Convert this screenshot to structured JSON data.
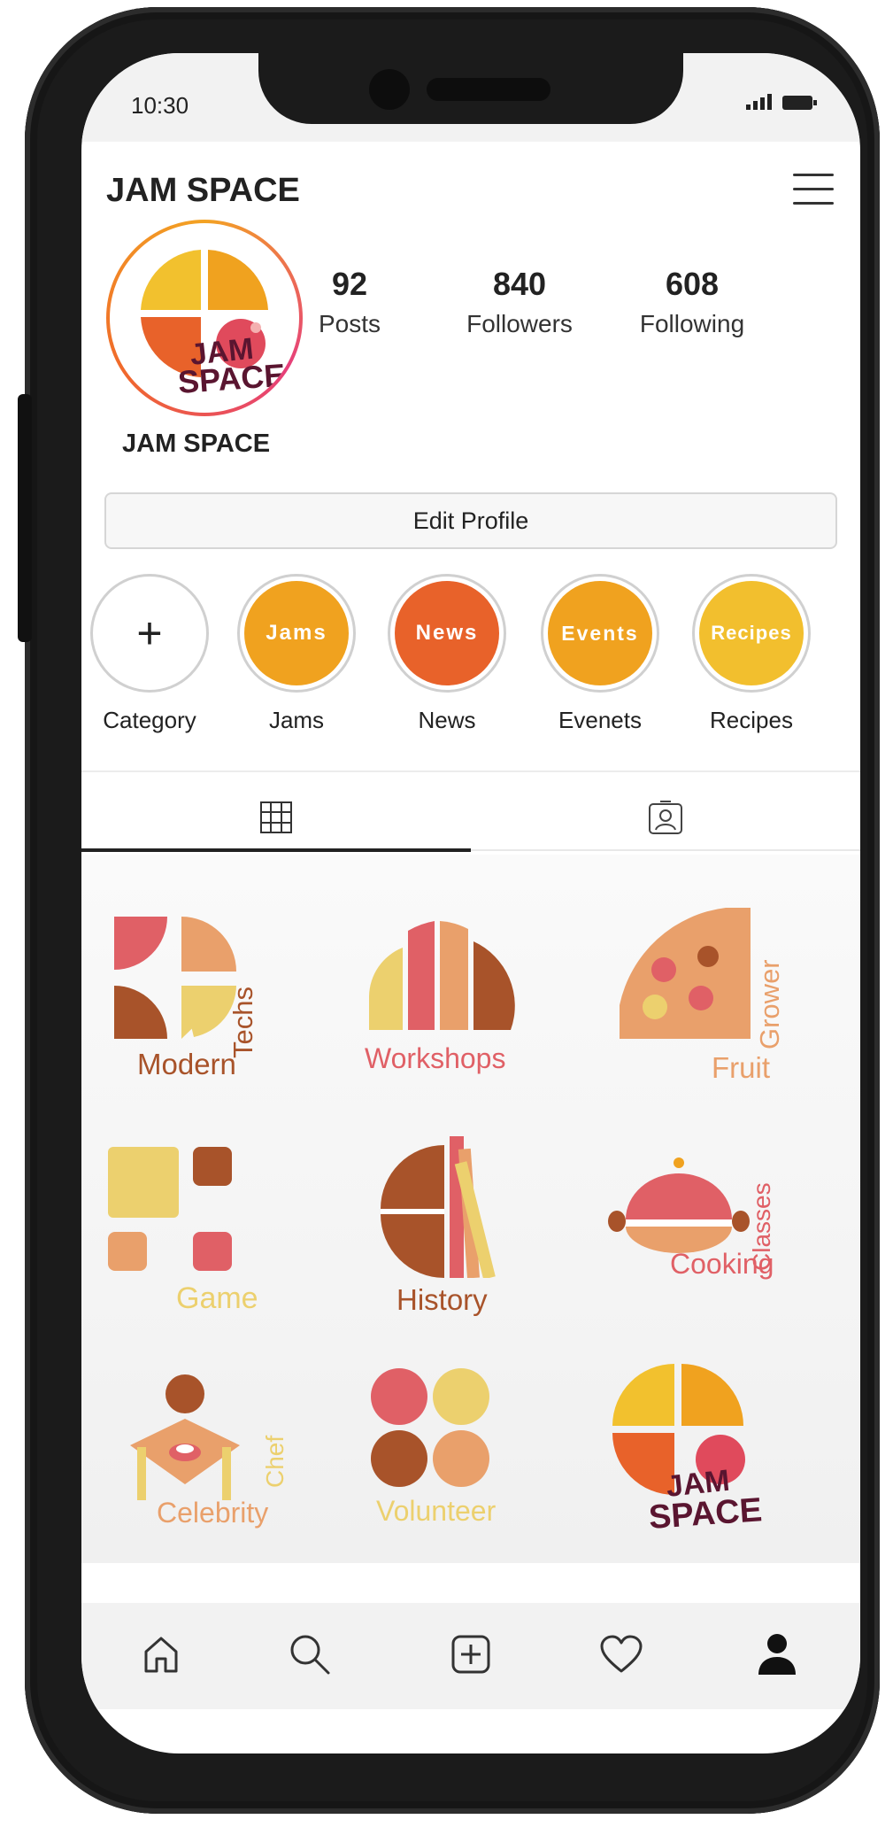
{
  "status_bar": {
    "time": "10:30"
  },
  "header": {
    "title": "JAM SPACE",
    "menu_icon": "hamburger-menu-icon"
  },
  "profile": {
    "avatar_text_line1": "JAM",
    "avatar_text_line2": "SPACE",
    "name": "JAM SPACE",
    "stats": [
      {
        "value": "92",
        "label": "Posts"
      },
      {
        "value": "840",
        "label": "Followers"
      },
      {
        "value": "608",
        "label": "Following"
      }
    ],
    "edit_button": "Edit Profile"
  },
  "highlights": [
    {
      "caption": "Category",
      "inner": "+",
      "color": "#ffffff"
    },
    {
      "caption": "Jams",
      "inner": "Jams",
      "color": "#f0a21f"
    },
    {
      "caption": "News",
      "inner": "News",
      "color": "#e8622a"
    },
    {
      "caption": "Evenets",
      "inner": "Events",
      "color": "#f0a21f"
    },
    {
      "caption": "Recipes",
      "inner": "Recipes",
      "color": "#f2bf2e"
    }
  ],
  "tabs": [
    {
      "name": "grid",
      "icon": "grid-icon"
    },
    {
      "name": "tagged",
      "icon": "tagged-person-icon"
    }
  ],
  "posts": [
    {
      "title": "Modern",
      "subtitle": "Techs"
    },
    {
      "title": "Workshops",
      "subtitle": ""
    },
    {
      "title": "Fruit",
      "subtitle": "Grower"
    },
    {
      "title": "Game",
      "subtitle": ""
    },
    {
      "title": "History",
      "subtitle": ""
    },
    {
      "title": "Cooking",
      "subtitle": "Classes"
    },
    {
      "title": "Celebrity",
      "subtitle": "Chef"
    },
    {
      "title": "Volunteer",
      "subtitle": ""
    },
    {
      "title": "JAM",
      "subtitle": "SPACE"
    }
  ],
  "bottom_nav": [
    {
      "icon": "home-icon"
    },
    {
      "icon": "search-icon"
    },
    {
      "icon": "add-post-icon"
    },
    {
      "icon": "heart-icon"
    },
    {
      "icon": "profile-icon"
    }
  ],
  "colors": {
    "yellow": "#f2c12e",
    "orange": "#f0a21f",
    "red_orange": "#e8622a",
    "pink_red": "#e06066",
    "peach": "#e9a06b",
    "brown": "#a8532a",
    "light_yellow": "#ecd06e",
    "dark_maroon": "#5a1530"
  }
}
